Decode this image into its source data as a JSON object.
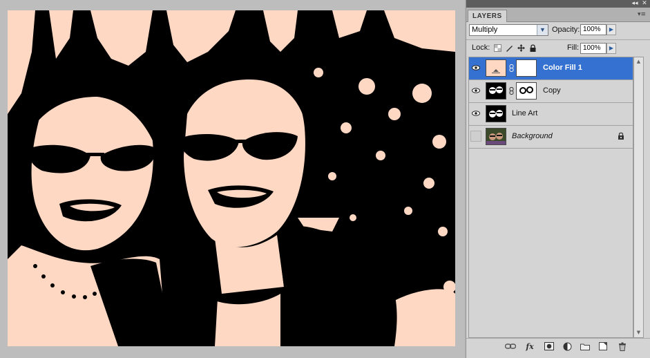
{
  "panel": {
    "tab_label": "LAYERS",
    "collapse_glyph": "◂◂",
    "close_glyph": "✕",
    "menu_glyph": "▾≡",
    "blend_mode": "Multiply",
    "blend_arrow": "▼",
    "opacity_label": "Opacity:",
    "opacity_value": "100%",
    "lock_label": "Lock:",
    "fill_label": "Fill:",
    "fill_value": "100%",
    "flyout_glyph": "▶"
  },
  "layers": [
    {
      "name": "Color Fill 1",
      "visible": true,
      "selected": true,
      "type": "fill-with-mask"
    },
    {
      "name": "Copy",
      "visible": true,
      "selected": false,
      "type": "image-with-mask"
    },
    {
      "name": "Line Art",
      "visible": true,
      "selected": false,
      "type": "image"
    },
    {
      "name": "Background",
      "visible": false,
      "selected": false,
      "type": "background",
      "locked": true
    }
  ],
  "bottom_icons": [
    "link-layers-icon",
    "fx-icon",
    "add-mask-icon",
    "adjustment-layer-icon",
    "new-group-icon",
    "new-layer-icon",
    "delete-layer-icon"
  ],
  "bottom_glyphs": {
    "fx": "fx"
  },
  "colors": {
    "fill_color": "#ffd8c4",
    "selection": "#3471d0",
    "panel_bg": "#d4d4d4"
  }
}
